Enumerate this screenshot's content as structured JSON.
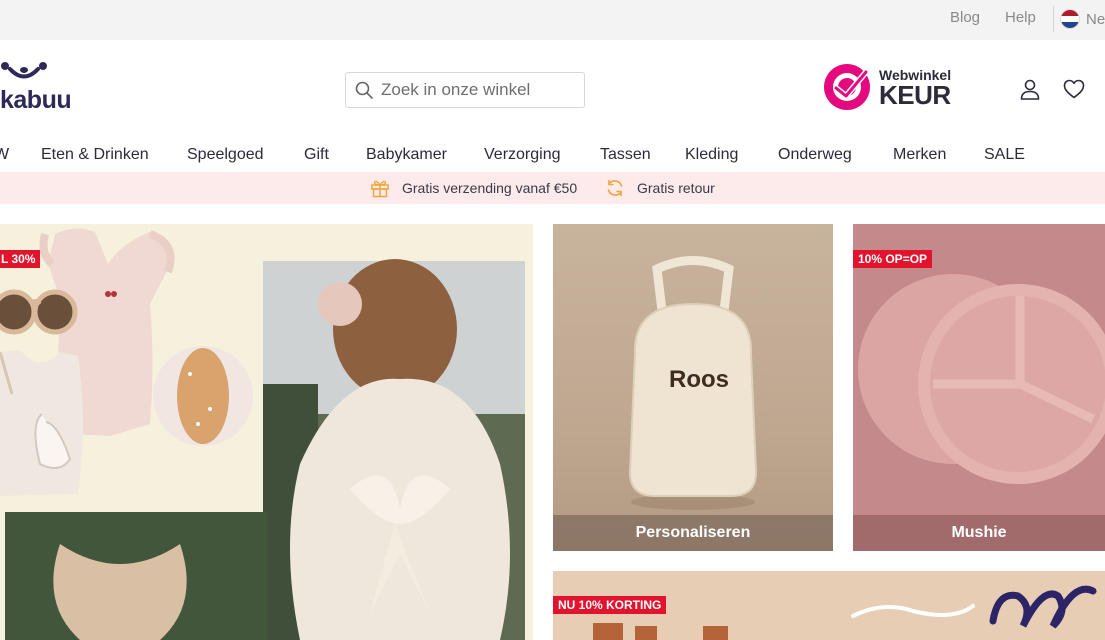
{
  "topbar": {
    "links": [
      "Blog",
      "Help"
    ],
    "language": {
      "code": "Ne",
      "flag_colors": [
        "#ae1c28",
        "#ffffff",
        "#21468b"
      ]
    }
  },
  "header": {
    "logo_text": "kabuu",
    "search": {
      "placeholder": "Zoek in onze winkel",
      "value": ""
    },
    "trust_badge": {
      "line1": "Webwinkel",
      "line2": "KEUR"
    },
    "icons": [
      "user-icon",
      "heart-icon"
    ]
  },
  "nav": {
    "items": [
      "W",
      "Eten & Drinken",
      "Speelgoed",
      "Gift",
      "Babykamer",
      "Verzorging",
      "Tassen",
      "Kleding",
      "Onderweg",
      "Merken",
      "SALE"
    ]
  },
  "usp": {
    "items": [
      {
        "icon": "gift-box-icon",
        "text": "Gratis verzending vanaf €50"
      },
      {
        "icon": "refresh-arrows-icon",
        "text": "Gratis retour"
      }
    ]
  },
  "tiles": {
    "hero": {
      "tag": "L 30%"
    },
    "personaliseren": {
      "caption": "Personaliseren",
      "product_text": "Roos"
    },
    "mushie": {
      "tag": "10% OP=OP",
      "caption": "Mushie"
    },
    "back": {
      "tag": "NU 10% KORTING"
    }
  },
  "colors": {
    "brand": "#2d2a5a",
    "keur_pink": "#e5097f",
    "usp_bg": "#fdeaea",
    "usp_icon": "#f0a63a",
    "sale_tag": "#e2142d"
  }
}
